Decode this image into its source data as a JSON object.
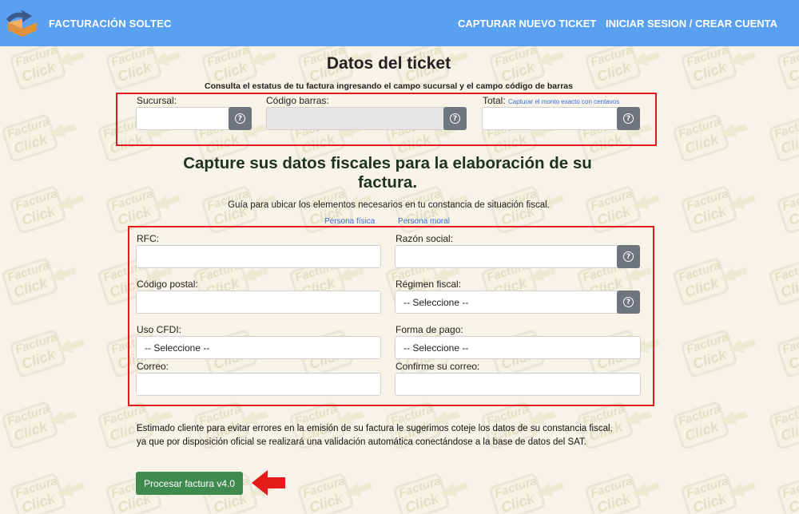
{
  "navbar": {
    "brand": "FACTURACIÓN SOLTEC",
    "new_ticket": "CAPTURAR NUEVO TICKET",
    "login": "INICIAR SESION / CREAR CUENTA",
    "bg_color": "#5aa0f0"
  },
  "watermark": {
    "line1": "Factura",
    "line2": "Click"
  },
  "ticket": {
    "title": "Datos del ticket",
    "subtitle": "Consulta el estatus de tu factura ingresando el campo sucursal y el campo código de barras",
    "sucursal_label": "Sucursal:",
    "sucursal_value": "",
    "codigo_label": "Código barras:",
    "codigo_value": "",
    "total_label": "Total:",
    "total_hint": "Capturar el monto exacto con centavos",
    "total_value": ""
  },
  "fiscal": {
    "title": "Capture sus datos fiscales para la elaboración de su factura.",
    "guide": "Guía para ubicar los elementos necesarios en tu constancia de situación fiscal.",
    "link_fisica": "Persona física",
    "link_moral": "Persona moral",
    "rfc_label": "RFC:",
    "rfc_value": "",
    "razon_label": "Razón social:",
    "razon_value": "",
    "cp_label": "Código postal:",
    "cp_value": "",
    "regimen_label": "Régimen fiscal:",
    "regimen_value": "-- Seleccione --",
    "uso_label": "Uso CFDI:",
    "uso_value": "-- Seleccione --",
    "forma_label": "Forma de pago:",
    "forma_value": "-- Seleccione --",
    "correo_label": "Correo:",
    "correo_value": "",
    "confirm_label": "Confirme su correo:",
    "confirm_value": ""
  },
  "notice": {
    "line1": "Estimado cliente para evitar errores en la emisión de su factura le sugerimos coteje los datos de su constancia fiscal,",
    "line2": "ya que por disposición oficial se realizará una validación automática conectándose a la base de datos del SAT."
  },
  "submit": {
    "label": "Procesar factura v4.0",
    "color": "#3f8a4f"
  },
  "icons": {
    "help": "question-circle-icon",
    "arrow": "red-arrow-left-icon"
  }
}
